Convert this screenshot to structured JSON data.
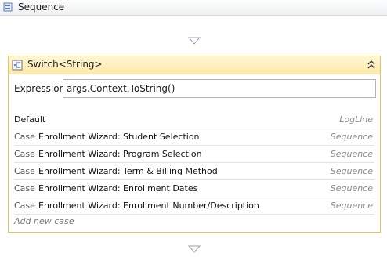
{
  "sequence": {
    "title": "Sequence"
  },
  "switch": {
    "title": "Switch<String>",
    "expression_label": "Expression",
    "expression_value": "args.Context.ToString()",
    "default": {
      "label": "Default",
      "activity": "LogLine"
    },
    "case_keyword": "Case",
    "cases": [
      {
        "value": "Enrollment Wizard: Student Selection",
        "activity": "Sequence"
      },
      {
        "value": "Enrollment Wizard: Program Selection",
        "activity": "Sequence"
      },
      {
        "value": "Enrollment Wizard: Term & Billing Method",
        "activity": "Sequence"
      },
      {
        "value": "Enrollment Wizard: Enrollment Dates",
        "activity": "Sequence"
      },
      {
        "value": "Enrollment Wizard: Enrollment Number/Description",
        "activity": "Sequence"
      }
    ],
    "add_case": "Add new case"
  },
  "colors": {
    "switch_border": "#e5c365",
    "switch_header": "#fde9a6",
    "arrow": "#9aa3b0"
  },
  "icons": {
    "sequence": "sequence-icon",
    "switch": "switch-icon",
    "collapse": "collapse-chevron-icon",
    "drop": "drop-arrow-icon"
  }
}
